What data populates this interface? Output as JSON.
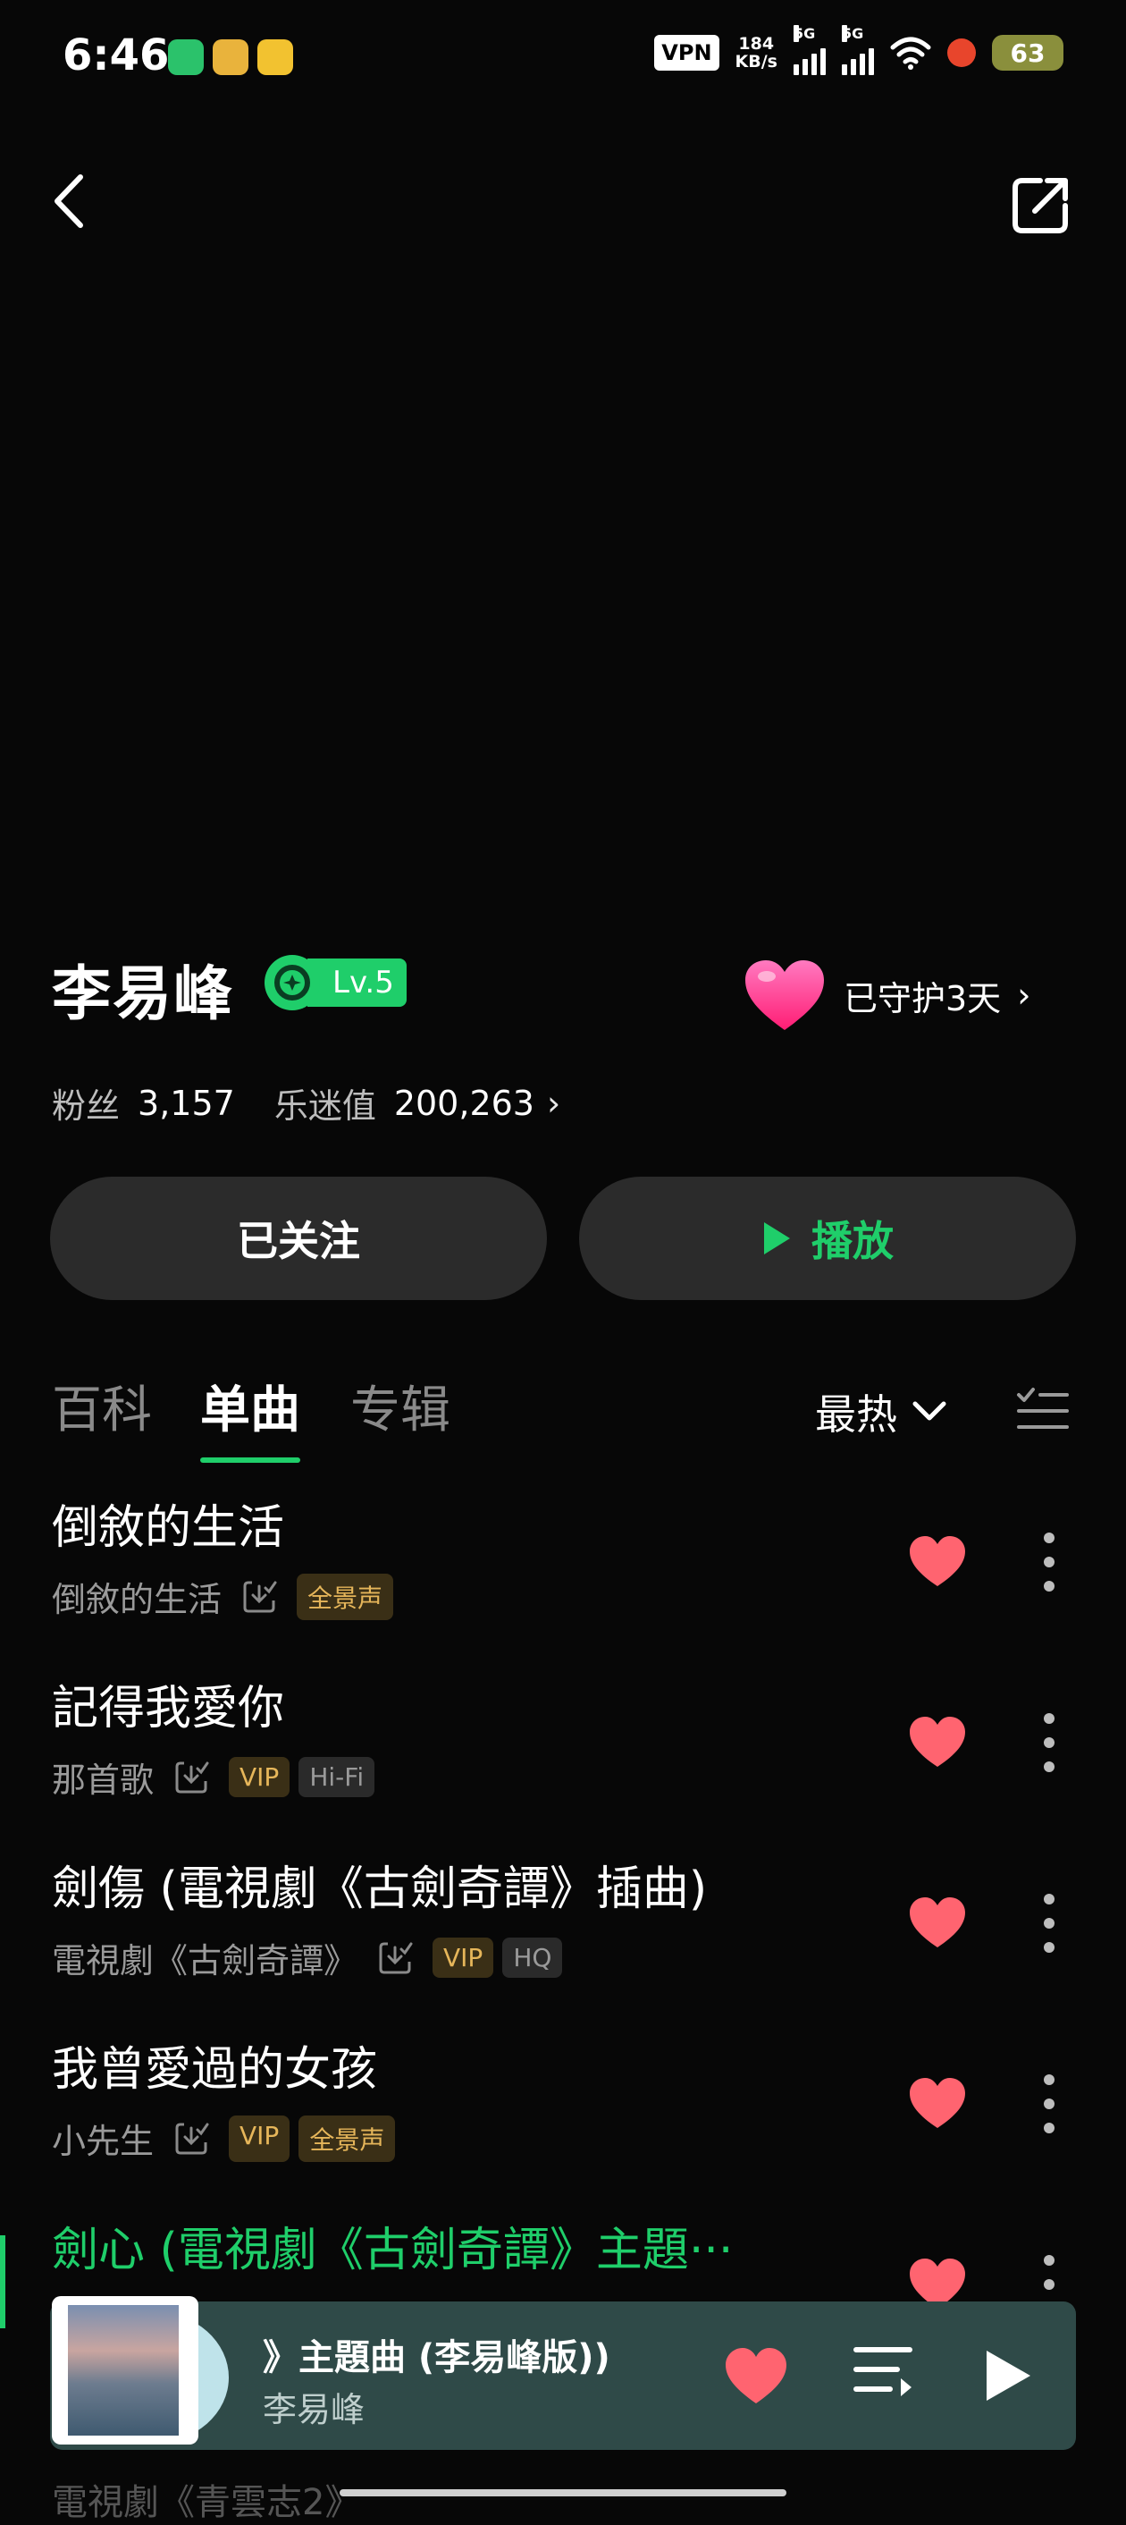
{
  "status_bar": {
    "time": "6:46",
    "vpn": "VPN",
    "speed_value": "184",
    "speed_unit": "KB/s",
    "net1": "5G",
    "net2": "5G",
    "battery": "63"
  },
  "artist": {
    "name": "李易峰",
    "level": "Lv.5",
    "guard_text": "已守护3天",
    "fans_label": "粉丝",
    "fans_value": "3,157",
    "fanvalue_label": "乐迷值",
    "fanvalue_value": "200,263"
  },
  "actions": {
    "follow_label": "已关注",
    "play_label": "播放"
  },
  "tabs": [
    {
      "label": "百科"
    },
    {
      "label": "单曲"
    },
    {
      "label": "专辑"
    }
  ],
  "sort_label": "最热",
  "songs": [
    {
      "title": "倒敘的生活",
      "album": "倒敘的生活",
      "tags": [
        "全景声"
      ]
    },
    {
      "title": "記得我愛你",
      "album": "那首歌",
      "tags": [
        "VIP",
        "Hi-Fi"
      ]
    },
    {
      "title": "劍傷 (電視劇《古劍奇譚》插曲)",
      "album": "電視劇《古劍奇譚》",
      "tags": [
        "VIP",
        "HQ"
      ]
    },
    {
      "title": "我曾愛過的女孩",
      "album": "小先生",
      "tags": [
        "VIP",
        "全景声"
      ]
    },
    {
      "title": "劍心 (電視劇《古劍奇譚》主題···"
    }
  ],
  "player": {
    "title": "》主題曲 (李易峰版))",
    "artist": "李易峰"
  },
  "bottom_peek": "電視劇《青雲志2》",
  "colors": {
    "accent": "#1fce6a",
    "like": "#ff6470",
    "tag_gold": "#e6b65a",
    "player_bg": "#2f4a48"
  }
}
